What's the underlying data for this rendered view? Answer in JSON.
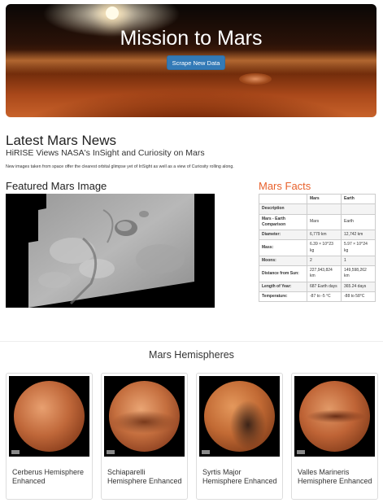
{
  "header": {
    "title": "Mission to Mars",
    "scrape_button": "Scrape New Data"
  },
  "news": {
    "heading": "Latest Mars News",
    "title": "HiRISE Views NASA's InSight and Curiosity on Mars",
    "paragraph": "New images taken from space offer the clearest orbital glimpse yet of InSight as well as a view of Curiosity rolling along."
  },
  "featured": {
    "heading": "Featured Mars Image"
  },
  "facts": {
    "heading": "Mars Facts",
    "columns": [
      "",
      "Mars",
      "Earth"
    ],
    "rows": [
      {
        "label": "Description",
        "mars": "",
        "earth": ""
      },
      {
        "label": "Mars - Earth Comparison",
        "mars": "Mars",
        "earth": "Earth"
      },
      {
        "label": "Diameter:",
        "mars": "6,779 km",
        "earth": "12,742 km"
      },
      {
        "label": "Mass:",
        "mars": "6.39 × 10^23 kg",
        "earth": "5.97 × 10^24 kg"
      },
      {
        "label": "Moons:",
        "mars": "2",
        "earth": "1"
      },
      {
        "label": "Distance from Sun:",
        "mars": "227,943,824 km",
        "earth": "149,598,262 km"
      },
      {
        "label": "Length of Year:",
        "mars": "687 Earth days",
        "earth": "365.24 days"
      },
      {
        "label": "Temperature:",
        "mars": "-87 to -5 °C",
        "earth": "-88 to 58°C"
      }
    ]
  },
  "hemispheres": {
    "heading": "Mars Hemispheres",
    "items": [
      {
        "title": "Cerberus Hemisphere Enhanced"
      },
      {
        "title": "Schiaparelli Hemisphere Enhanced"
      },
      {
        "title": "Syrtis Major Hemisphere Enhanced"
      },
      {
        "title": "Valles Marineris Hemisphere Enhanced"
      }
    ]
  },
  "colors": {
    "button": "#337ab7",
    "facts_heading": "#e8612c"
  }
}
